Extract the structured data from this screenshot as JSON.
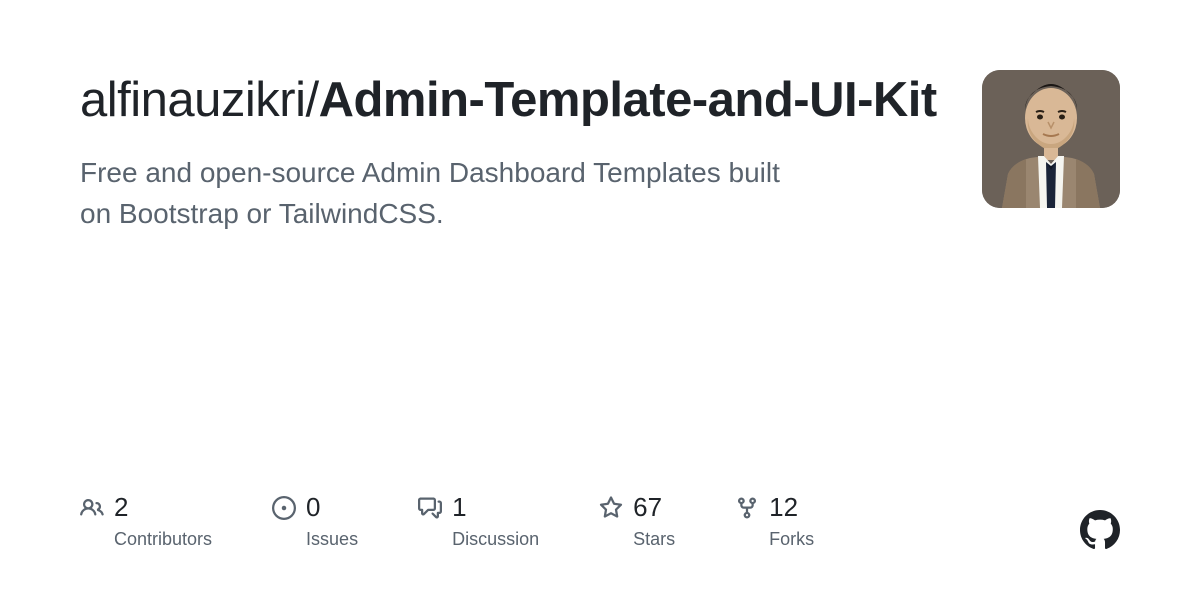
{
  "repo": {
    "owner": "alfinauzikri",
    "separator": "/",
    "name": "Admin-Template-and-UI-Kit",
    "description": "Free and open-source Admin Dashboard Templates built on Bootstrap or TailwindCSS."
  },
  "stats": {
    "contributors": {
      "value": "2",
      "label": "Contributors"
    },
    "issues": {
      "value": "0",
      "label": "Issues"
    },
    "discussion": {
      "value": "1",
      "label": "Discussion"
    },
    "stars": {
      "value": "67",
      "label": "Stars"
    },
    "forks": {
      "value": "12",
      "label": "Forks"
    }
  }
}
